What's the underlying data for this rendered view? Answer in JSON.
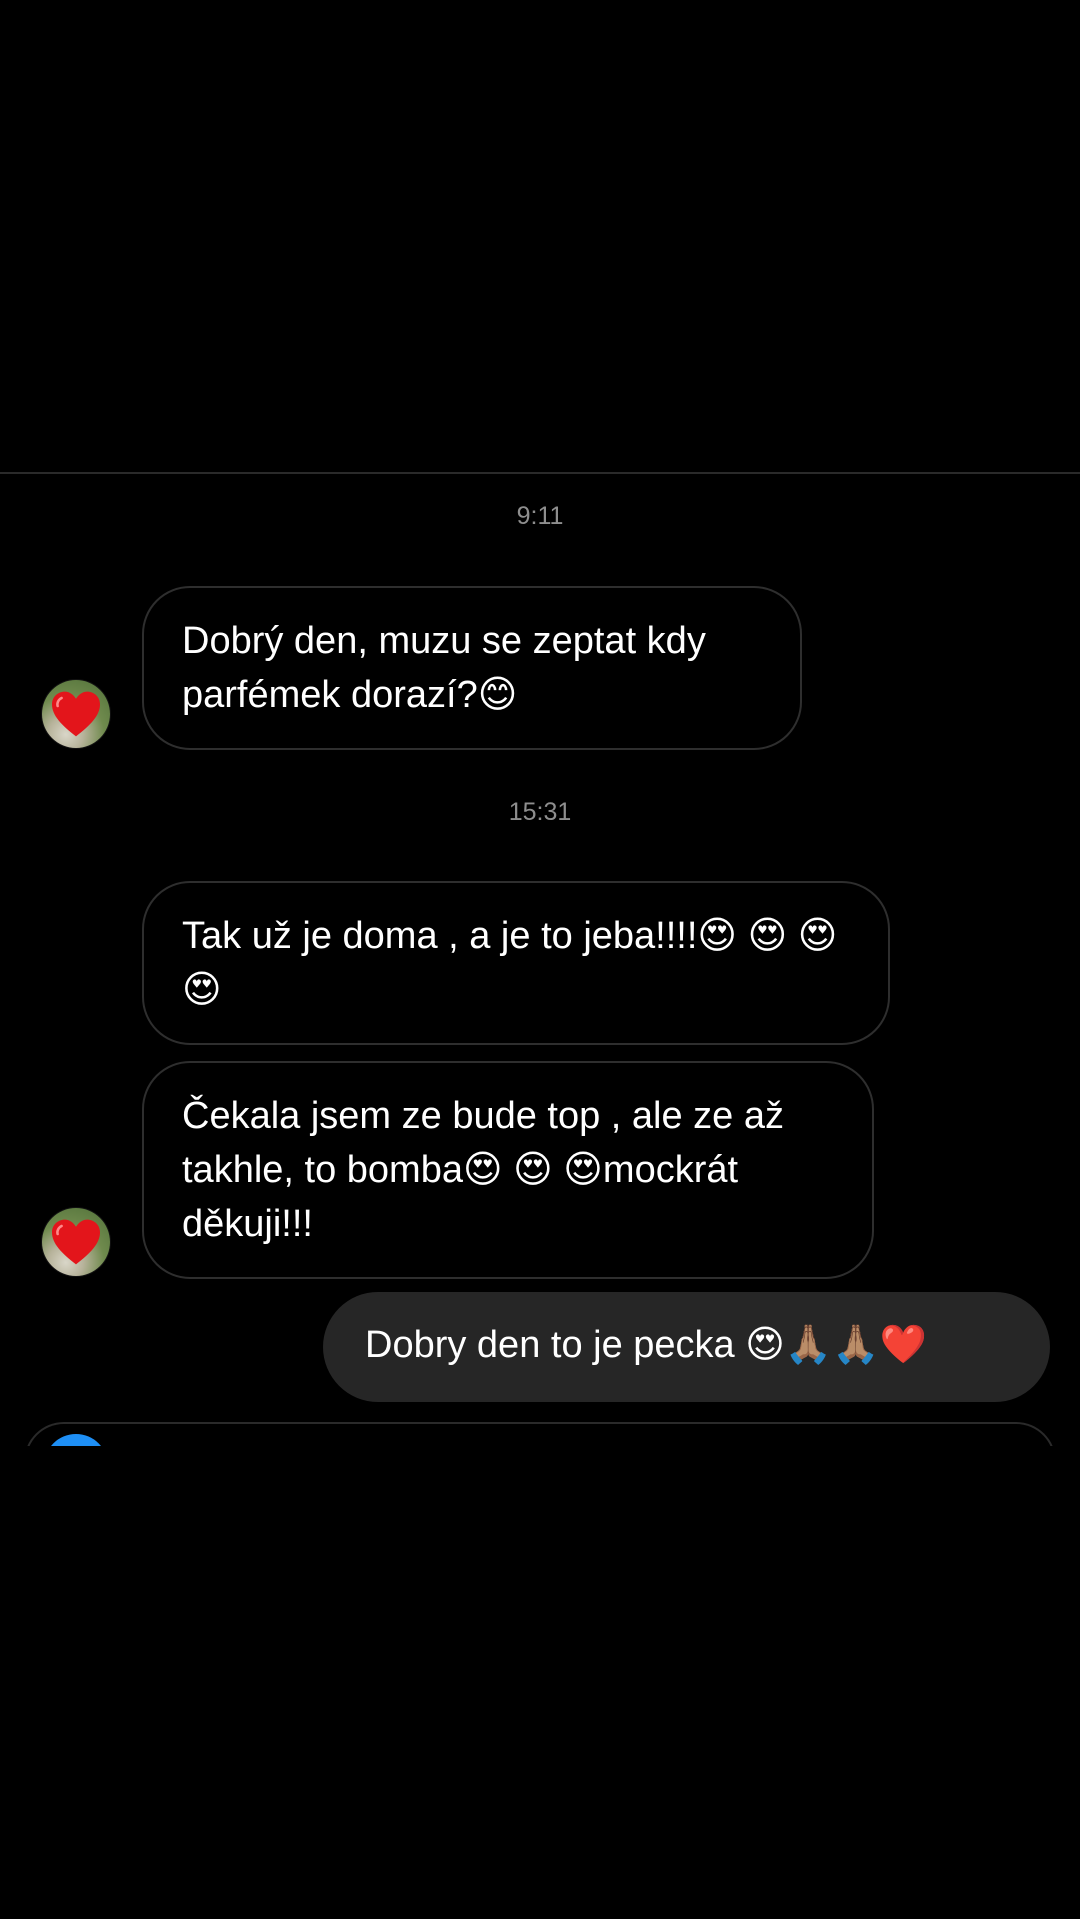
{
  "colors": {
    "background": "#000000",
    "received_border": "#2e2e2e",
    "sent_bubble": "#262626",
    "timestamp": "#8e8e8e",
    "camera_button": "#1e8ff5"
  },
  "thread": {
    "timestamps": [
      "9:11",
      "15:31"
    ],
    "messages": [
      {
        "from": "other",
        "text": "Dobrý den, muzu se zeptat kdy parfémek dorazí?😊"
      },
      {
        "from": "other",
        "text": "Tak už je doma , a je to jeba!!!!😍 😍 😍 😍"
      },
      {
        "from": "other",
        "text": "Čekala jsem ze bude top , ale ze až takhle, to bomba😍 😍 😍mockrát děkuji!!!"
      },
      {
        "from": "me",
        "text": "Dobry den to je pecka 😍🙏🏽🙏🏽❤️"
      }
    ]
  },
  "avatar": {
    "icon": "heart-icon"
  },
  "composer": {
    "icon": "camera-icon"
  }
}
